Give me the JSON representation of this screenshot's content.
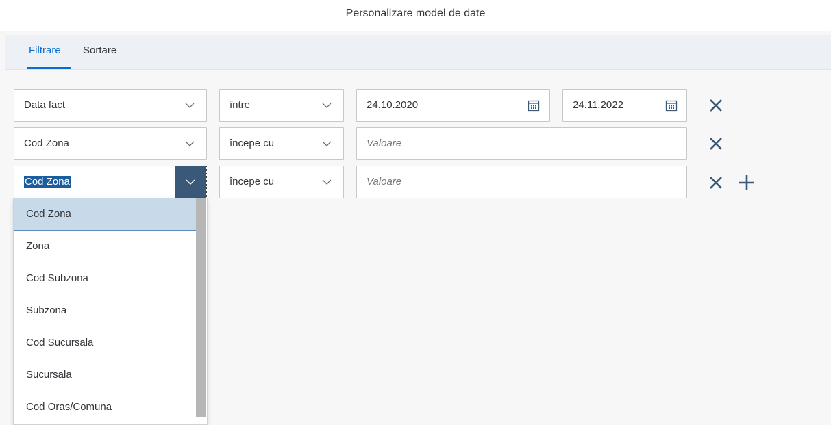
{
  "dialog": {
    "title": "Personalizare model de date"
  },
  "tabs": [
    {
      "label": "Filtrare",
      "active": true
    },
    {
      "label": "Sortare",
      "active": false
    }
  ],
  "filters": [
    {
      "field": "Data fact",
      "operator": "între",
      "value1": "24.10.2020",
      "value2": "24.11.2022"
    },
    {
      "field": "Cod Zona",
      "operator": "începe cu",
      "value_placeholder": "Valoare"
    },
    {
      "field": "Cod Zona",
      "operator": "începe cu",
      "value_placeholder": "Valoare"
    }
  ],
  "dropdown": {
    "items": [
      "Cod Zona",
      "Zona",
      "Cod Subzona",
      "Subzona",
      "Cod Sucursala",
      "Sucursala",
      "Cod Oras/Comuna"
    ],
    "selected": "Cod Zona"
  },
  "icons": {
    "chevron": "chevron-down-icon",
    "calendar": "calendar-icon",
    "remove": "close-icon",
    "add": "plus-icon"
  },
  "colors": {
    "accent": "#0a6ed1",
    "icon": "#3a5878",
    "selection": "#c8d9ea"
  }
}
